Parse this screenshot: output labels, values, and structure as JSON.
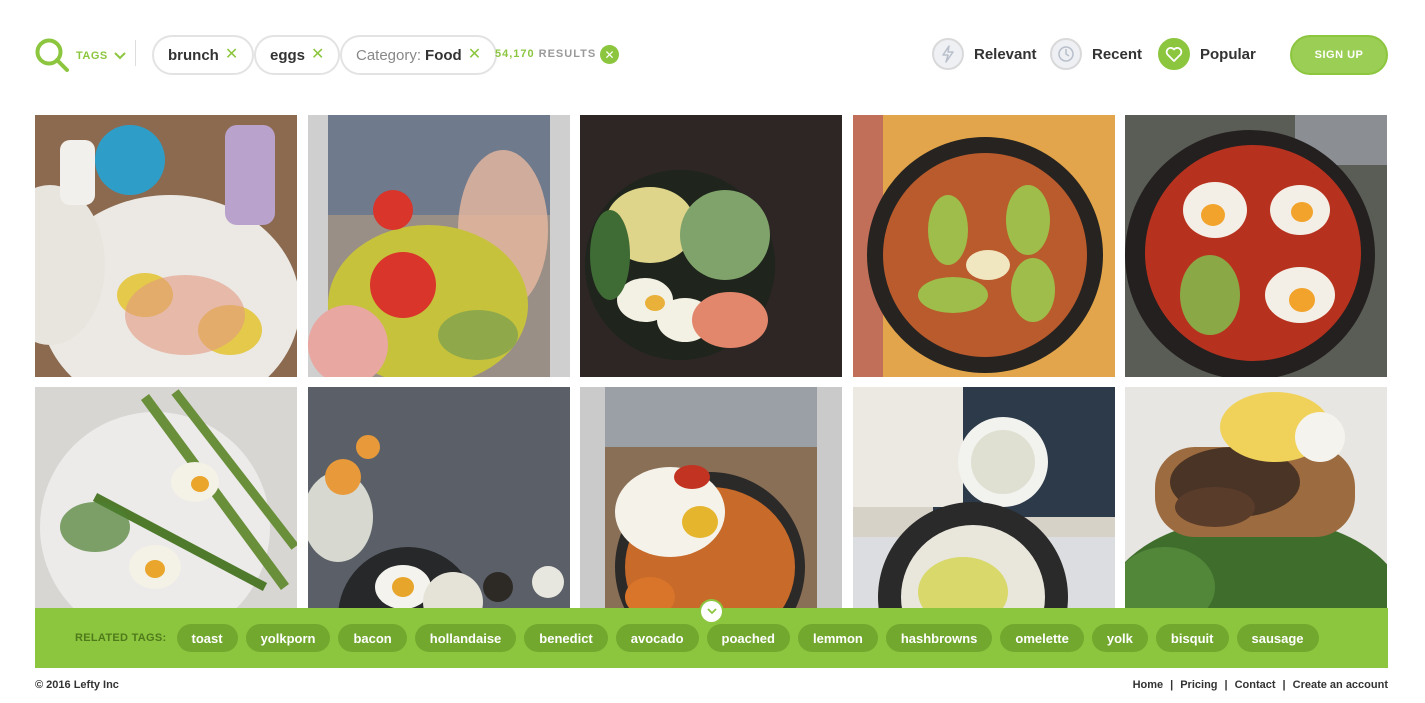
{
  "header": {
    "tags_label": "TAGS",
    "chips": [
      {
        "label": "brunch"
      },
      {
        "label": "eggs"
      },
      {
        "prefix": "Category: ",
        "label": "Food"
      }
    ],
    "results_count": "54,170",
    "results_label": "RESULTS",
    "sort": [
      {
        "label": "Relevant",
        "icon": "lightning-icon",
        "active": false
      },
      {
        "label": "Recent",
        "icon": "clock-icon",
        "active": false
      },
      {
        "label": "Popular",
        "icon": "heart-icon",
        "active": true
      }
    ],
    "signup_label": "SIGN UP"
  },
  "colors": {
    "accent": "#8cc63f",
    "accent_dark": "#73a82e"
  },
  "grid": {
    "tiles": [
      {
        "subject": "eggs benedict with teapot and smoothie"
      },
      {
        "subject": "avocado toast with tomato and rosé wine"
      },
      {
        "subject": "bowl with eggs, cucumber and salmon"
      },
      {
        "subject": "skillet hash with avocado"
      },
      {
        "subject": "shakshuka pan with avocado"
      },
      {
        "subject": "plate with asparagus and eggs"
      },
      {
        "subject": "overhead dark table with fried egg"
      },
      {
        "subject": "poached egg over sweet potato hash"
      },
      {
        "subject": "cookbook with scrambled eggs"
      },
      {
        "subject": "eggs benedict with mushrooms and arugula"
      }
    ]
  },
  "related": {
    "label": "RELATED TAGS:",
    "tags": [
      "toast",
      "yolkporn",
      "bacon",
      "hollandaise",
      "benedict",
      "avocado",
      "poached",
      "lemmon",
      "hashbrowns",
      "omelette",
      "yolk",
      "bisquit",
      "sausage"
    ]
  },
  "footer": {
    "copyright": "© 2016 Lefty Inc",
    "links": [
      "Home",
      "Pricing",
      "Contact",
      "Create an account"
    ]
  }
}
